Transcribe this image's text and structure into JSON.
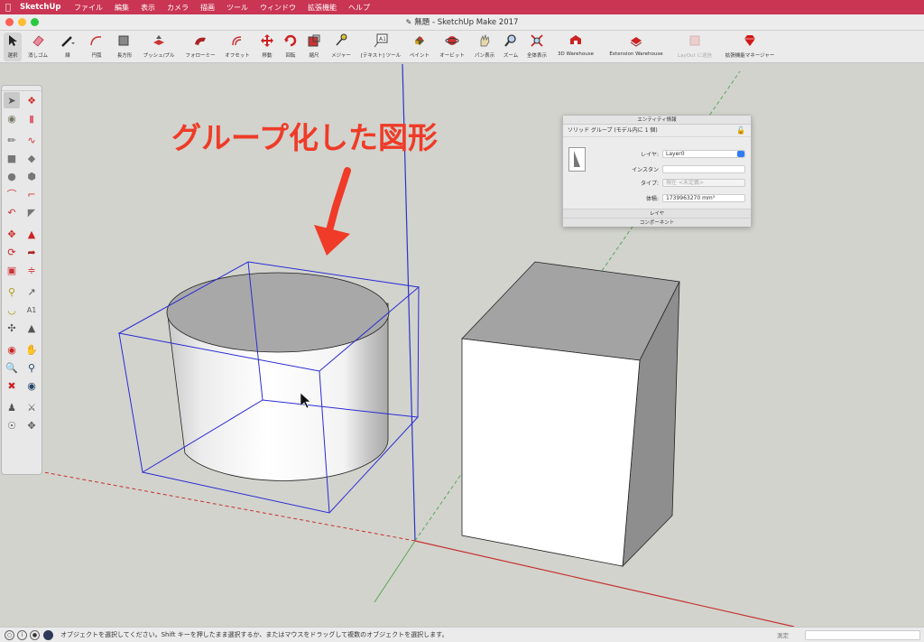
{
  "menubar": {
    "app_name": "SketchUp",
    "items": [
      "ファイル",
      "編集",
      "表示",
      "カメラ",
      "描画",
      "ツール",
      "ウィンドウ",
      "拡張機能",
      "ヘルプ"
    ]
  },
  "window": {
    "title": "無題 - SketchUp Make 2017"
  },
  "toolbar": {
    "select": "選択",
    "eraser": "消しゴム",
    "line": "線",
    "arc": "円弧",
    "rectangle": "長方形",
    "pushpull": "プッシュ/プル",
    "followme": "フォローミー",
    "offset": "オフセット",
    "move": "移動",
    "rotate": "回転",
    "scale": "縮尺",
    "tape": "メジャー",
    "text": "[テキスト] ツール",
    "paint": "ペイント",
    "orbit": "オービット",
    "pan": "パン表示",
    "zoom": "ズーム",
    "zoom_extents": "全体表示",
    "warehouse": "3D Warehouse",
    "ext_warehouse": "Extension Warehouse",
    "layout": "LayOut に送信",
    "ext_manager": "拡張機能マネージャー"
  },
  "annotation": {
    "text": "グループ化した図形"
  },
  "entity_info": {
    "title": "エンティティ情報",
    "header": "ソリッド グループ (モデル内に 1 個)",
    "layer_label": "レイヤ:",
    "layer_value": "Layer0",
    "instance_label": "インスタン",
    "instance_value": "",
    "type_label": "タイプ:",
    "type_value": "<未定義>",
    "type_prefix": "現在",
    "volume_label": "体積:",
    "volume_value": "1739963270 mm³",
    "section_layer": "レイヤ",
    "section_component": "コンポーネント"
  },
  "status": {
    "message": "オブジェクトを選択してください。Shift キーを押したまま選択するか、またはマウスをドラッグして複数のオブジェクトを選択します。",
    "measure_label": "測定"
  },
  "colors": {
    "menubar": "#c93553",
    "annotation": "#ef3b28",
    "selection_box": "#2b2bd4",
    "axis_blue": "#2233cc",
    "axis_red": "#cc2222",
    "axis_green": "#22aa22"
  }
}
